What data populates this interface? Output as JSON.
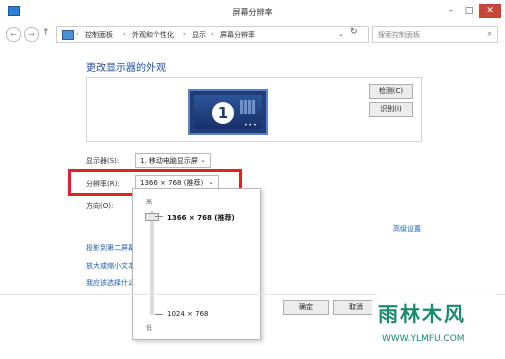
{
  "window": {
    "title": "屏幕分辨率",
    "min_label": "–",
    "max_label": "□",
    "close_label": "✕"
  },
  "address": {
    "crumbs": [
      "控制面板",
      "外观和个性化",
      "显示",
      "屏幕分辨率"
    ],
    "search_placeholder": "搜索控制面板"
  },
  "icons": {
    "back": "←",
    "forward": "→",
    "up": "↑",
    "refresh": "↻",
    "search": "⌕",
    "dropdown": "⌄",
    "chevron": "›"
  },
  "heading": "更改显示器的外观",
  "preview": {
    "monitor_number": "1",
    "detect_label": "检测(C)",
    "identify_label": "识别(I)"
  },
  "form": {
    "display_label": "显示器(S):",
    "display_value": "1. 移动电脑显示屏",
    "resolution_label": "分辨率(R):",
    "resolution_value": "1366 × 768 (推荐)",
    "orientation_label": "方向(O):",
    "advanced_link": "高级设置"
  },
  "popup": {
    "high_label": "高",
    "low_label": "低",
    "option_high": "1366 × 768 (推荐)",
    "option_low": "1024 × 768"
  },
  "links": [
    "投影到第二屏幕",
    "放大或缩小文本",
    "我应该选择什么"
  ],
  "footer": {
    "ok_label": "确定",
    "cancel_label": "取消"
  },
  "watermark": {
    "text": "雨林木风",
    "url": "WWW.YLMFU.COM"
  },
  "colors": {
    "accent": "#1e4f9a",
    "highlight_box": "#e2202a",
    "close_button": "#c7463a"
  }
}
